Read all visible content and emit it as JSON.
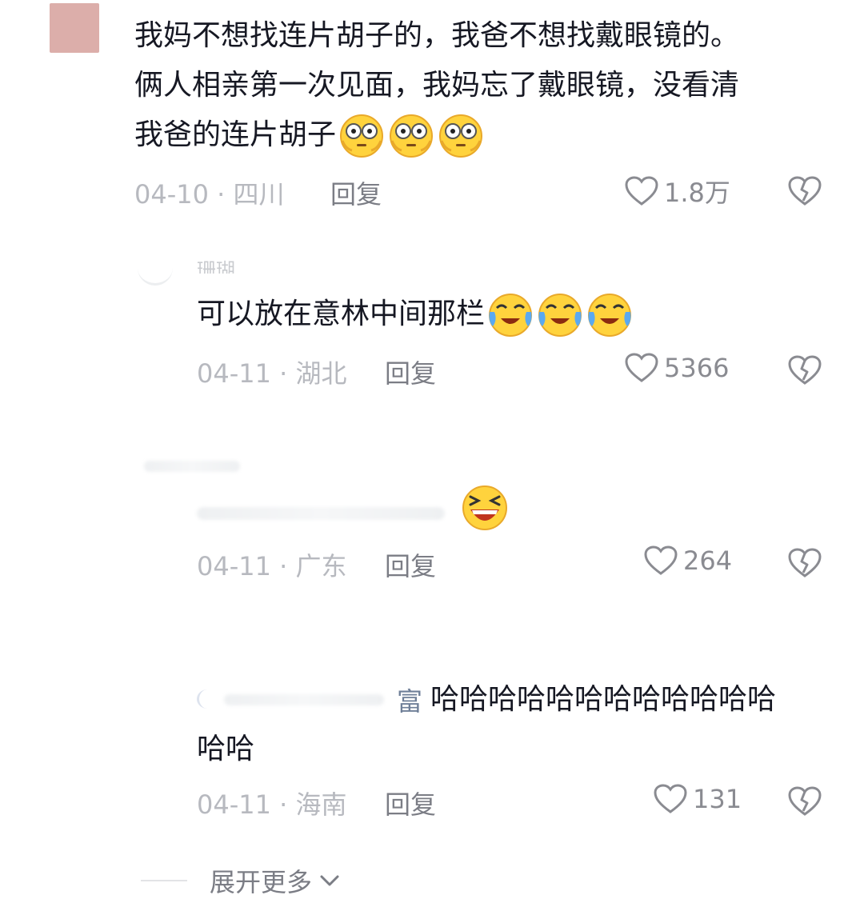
{
  "comments": [
    {
      "lines": [
        "我妈不想找连片胡子的，我爸不想找戴眼镜的。",
        "俩人相亲第一次见面，我妈忘了戴眼镜，没看清",
        "我爸的连片胡子"
      ],
      "emoji": "flushed-face-icon",
      "date": "04-10 · 四川",
      "reply": "回复",
      "likes": "1.8万"
    },
    {
      "username": "珊瑚",
      "lines": [
        "可以放在意林中间那栏"
      ],
      "emoji": "laugh-cry-face-icon",
      "date": "04-11 · 湖北",
      "reply": "回复",
      "likes": "5366"
    },
    {
      "emoji": "grinning-squint-face-icon",
      "date": "04-11 · 广东",
      "reply": "回复",
      "likes": "264"
    },
    {
      "username": "富",
      "lines": [
        "哈哈哈哈哈哈哈哈哈哈哈哈",
        "哈哈"
      ],
      "date": "04-11 · 海南",
      "reply": "回复",
      "likes": "131"
    }
  ],
  "expand_label": "展开更多",
  "colors": {
    "avatar": "#dcaeaa",
    "text": "#161823",
    "meta": "#b7b9bf",
    "reply": "#7b7d85"
  }
}
